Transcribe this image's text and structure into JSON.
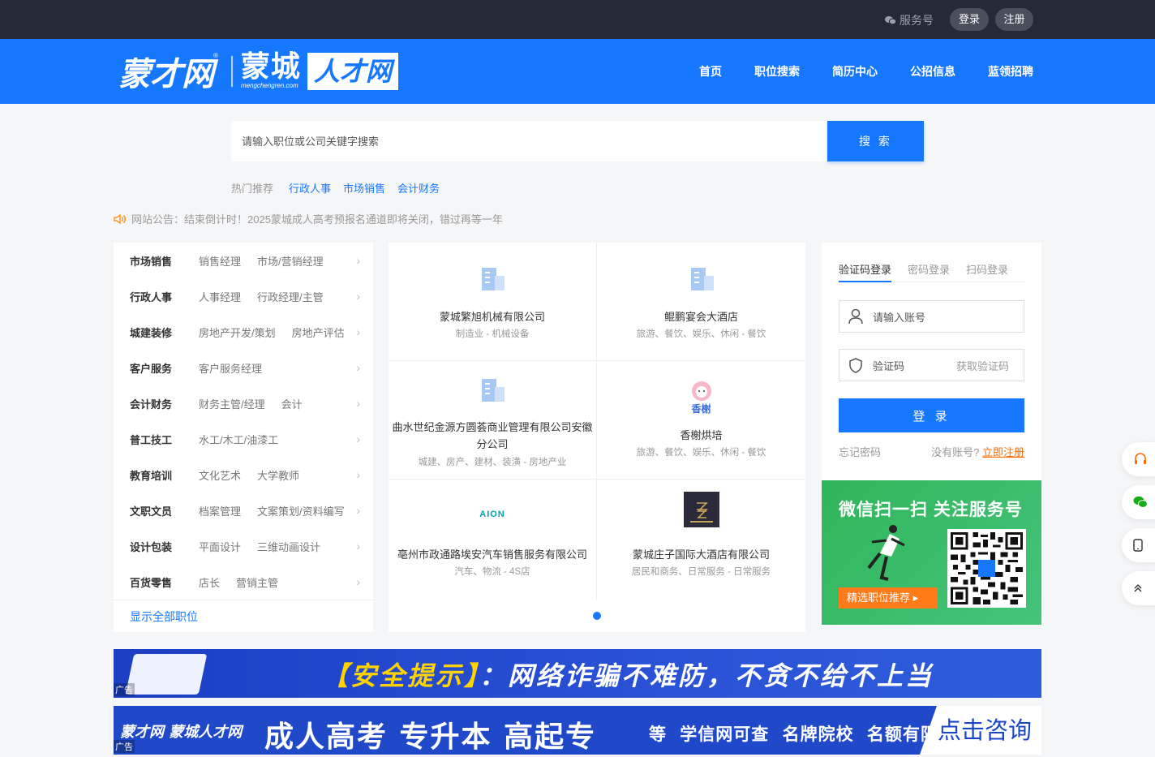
{
  "topbar": {
    "service": "服务号",
    "login": "登录",
    "register": "注册"
  },
  "header": {
    "logo_main": "蒙才网",
    "logo_city": "蒙城",
    "logo_domain": "mengchengren.com",
    "logo_talent": "人才网",
    "nav": [
      "首页",
      "职位搜索",
      "简历中心",
      "公招信息",
      "蓝领招聘"
    ]
  },
  "search": {
    "placeholder": "请输入职位或公司关键字搜索",
    "button": "搜 索"
  },
  "hot": {
    "label": "热门推荐",
    "items": [
      "行政人事",
      "市场销售",
      "会计财务"
    ]
  },
  "notice": {
    "text": "网站公告：结束倒计时！2025蒙城成人高考预报名通道即将关闭，错过再等一年"
  },
  "categories": [
    {
      "title": "市场销售",
      "subs": [
        "销售经理",
        "市场/营销经理"
      ]
    },
    {
      "title": "行政人事",
      "subs": [
        "人事经理",
        "行政经理/主管"
      ]
    },
    {
      "title": "城建装修",
      "subs": [
        "房地产开发/策划",
        "房地产评估"
      ]
    },
    {
      "title": "客户服务",
      "subs": [
        "客户服务经理"
      ]
    },
    {
      "title": "会计财务",
      "subs": [
        "财务主管/经理",
        "会计"
      ]
    },
    {
      "title": "普工技工",
      "subs": [
        "水工/木工/油漆工"
      ]
    },
    {
      "title": "教育培训",
      "subs": [
        "文化艺术",
        "大学教师"
      ]
    },
    {
      "title": "文职文员",
      "subs": [
        "档案管理",
        "文案策划/资料编写"
      ]
    },
    {
      "title": "设计包装",
      "subs": [
        "平面设计",
        "三维动画设计"
      ]
    },
    {
      "title": "百货零售",
      "subs": [
        "店长",
        "营销主管"
      ]
    }
  ],
  "show_all": "显示全部职位",
  "companies": [
    {
      "name": "蒙城繁旭机械有限公司",
      "industry": "制造业 - 机械设备",
      "logo": "building-icon"
    },
    {
      "name": "鲲鹏宴会大酒店",
      "industry": "旅游、餐饮、娱乐、休闲 - 餐饮",
      "logo": "building-icon"
    },
    {
      "name": "曲水世纪金源方圆荟商业管理有限公司安徽分公司",
      "industry": "城建、房产、建材、装潢 - 房地产业",
      "logo": "building-icon"
    },
    {
      "name": "香榭烘培",
      "industry": "旅游、餐饮、娱乐、休闲 - 餐饮",
      "logo": "bakery-logo",
      "logo_text": "香榭"
    },
    {
      "name": "亳州市政通路埃安汽车销售服务有限公司",
      "industry": "汽车、物流 - 4S店",
      "logo": "aion-logo",
      "logo_text": "AION"
    },
    {
      "name": "蒙城庄子国际大酒店有限公司",
      "industry": "居民和商务、日常服务 - 日常服务",
      "logo": "hotel-logo"
    }
  ],
  "login": {
    "tabs": [
      "验证码登录",
      "密码登录",
      "扫码登录"
    ],
    "account_placeholder": "请输入账号",
    "code_placeholder": "验证码",
    "get_code": "获取验证码",
    "submit": "登 录",
    "forgot": "忘记密码",
    "no_account": "没有账号?",
    "register_now": "立即注册"
  },
  "wechat": {
    "title": "微信扫一扫 关注服务号",
    "button": "精选职位推荐"
  },
  "ads": {
    "ad1_text_a": "【安全提示】",
    "ad1_text_b": "：网络诈骗不难防，不贪不给不上当",
    "ad2_brand": "蒙才网 蒙城人才网",
    "ad2_big": "成人高考 专升本 高起专",
    "ad2_mid": "等 学信网可查 名牌院校 名额有限",
    "ad2_cta": "点击咨询",
    "tag": "广告"
  },
  "colors": {
    "brand": "#1677ff",
    "topbar": "#262a36",
    "accent": "#ff7a18",
    "green": "#2fb55a"
  }
}
